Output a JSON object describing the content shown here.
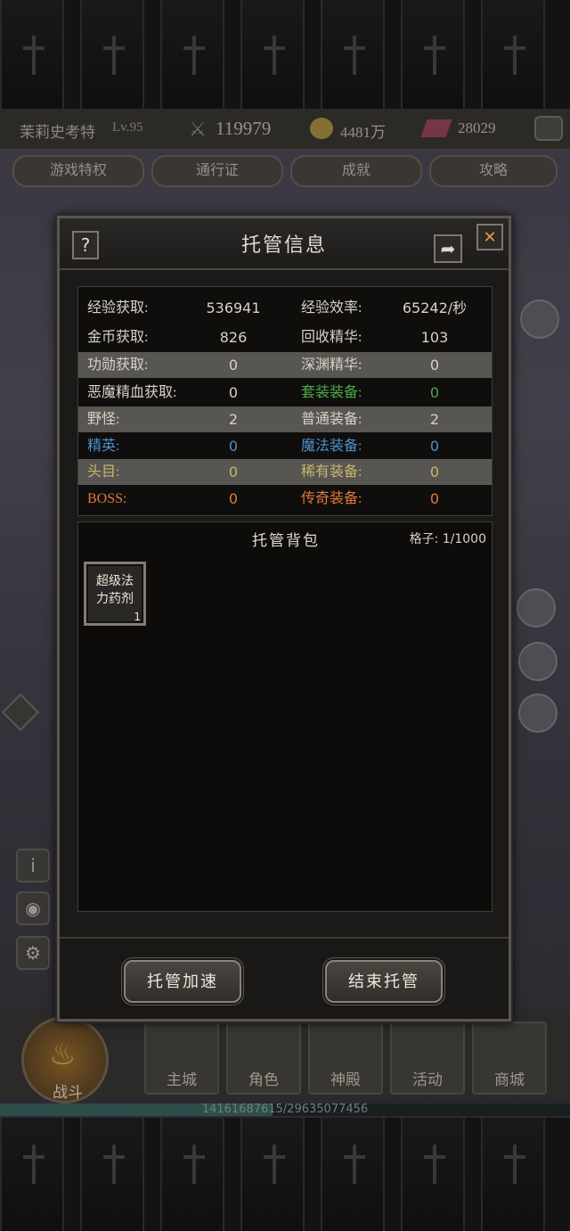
{
  "colors": {
    "normal": "#d8d2c4",
    "set": "#4ea84a",
    "magic": "#4f8fcf",
    "rare": "#c9b56a",
    "legend": "#e0783a",
    "band": "#585653"
  },
  "player": {
    "name": "茉莉史考特",
    "level": "Lv.95",
    "power": "119979",
    "gold": "4481万",
    "gems": "28029"
  },
  "top_menu": [
    {
      "label": "游戏特权"
    },
    {
      "label": "通行证"
    },
    {
      "label": "成就"
    },
    {
      "label": "攻略"
    }
  ],
  "dialog": {
    "title": "托管信息",
    "help_label": "?",
    "close_label": "✕",
    "stats": [
      {
        "l_label": "经验获取:",
        "l_value": "536941",
        "r_label": "经验效率:",
        "r_value": "65242/秒",
        "band": false,
        "l_color": "normal",
        "r_color": "normal"
      },
      {
        "l_label": "金币获取:",
        "l_value": "826",
        "r_label": "回收精华:",
        "r_value": "103",
        "band": false,
        "l_color": "normal",
        "r_color": "normal"
      },
      {
        "l_label": "功勋获取:",
        "l_value": "0",
        "r_label": "深渊精华:",
        "r_value": "0",
        "band": true,
        "l_color": "normal",
        "r_color": "normal"
      },
      {
        "l_label": "恶魔精血获取:",
        "l_value": "0",
        "r_label": "套装装备:",
        "r_value": "0",
        "band": false,
        "l_color": "normal",
        "r_color": "set"
      },
      {
        "l_label": "野怪:",
        "l_value": "2",
        "r_label": "普通装备:",
        "r_value": "2",
        "band": true,
        "l_color": "normal",
        "r_color": "normal"
      },
      {
        "l_label": "精英:",
        "l_value": "0",
        "r_label": "魔法装备:",
        "r_value": "0",
        "band": false,
        "l_color": "magic",
        "r_color": "magic"
      },
      {
        "l_label": "头目:",
        "l_value": "0",
        "r_label": "稀有装备:",
        "r_value": "0",
        "band": true,
        "l_color": "rare",
        "r_color": "rare"
      },
      {
        "l_label": "BOSS:",
        "l_value": "0",
        "r_label": "传奇装备:",
        "r_value": "0",
        "band": false,
        "l_color": "legend",
        "r_color": "legend"
      }
    ],
    "bag": {
      "title": "托管背包",
      "slots": "格子: 1/1000",
      "items": [
        {
          "name": "超级法力药剂",
          "qty": "1"
        }
      ]
    },
    "speed_button": "托管加速",
    "end_button": "结束托管"
  },
  "nav": [
    {
      "label": "战斗"
    },
    {
      "label": "主城"
    },
    {
      "label": "角色"
    },
    {
      "label": "神殿"
    },
    {
      "label": "活动"
    },
    {
      "label": "商城"
    }
  ],
  "exp": {
    "text": "14161687615/29635077456",
    "fraction": 0.478
  }
}
